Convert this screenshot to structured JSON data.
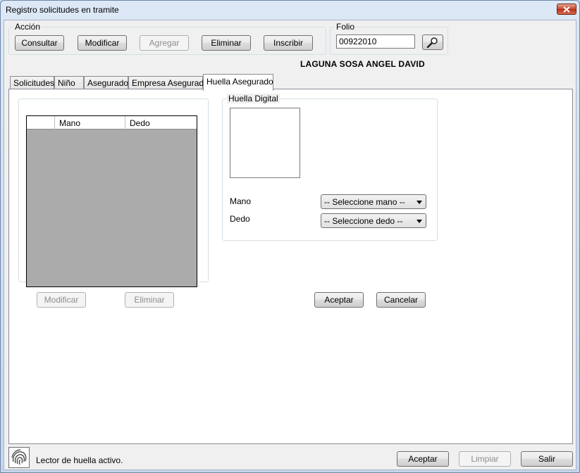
{
  "window": {
    "title": "Registro solicitudes en tramite"
  },
  "accion": {
    "legend": "Acción",
    "buttons": {
      "consultar": "Consultar",
      "modificar": "Modificar",
      "agregar": "Agregar",
      "eliminar": "Eliminar",
      "inscribir": "Inscribir"
    }
  },
  "folio": {
    "legend": "Folio",
    "value": "00922010"
  },
  "asegurado_nombre": "LAGUNA SOSA ANGEL DAVID",
  "tabs": [
    {
      "label": "Solicitudes"
    },
    {
      "label": "Niño"
    },
    {
      "label": "Asegurado"
    },
    {
      "label": "Empresa Asegurado"
    },
    {
      "label": "Huella Asegurado"
    }
  ],
  "active_tab": "Huella Asegurado",
  "grid": {
    "columns": [
      "Mano",
      "Dedo"
    ]
  },
  "grid_buttons": {
    "modificar": "Modificar",
    "eliminar": "Eliminar"
  },
  "huella": {
    "legend": "Huella Digital",
    "mano_label": "Mano",
    "dedo_label": "Dedo",
    "mano_select": "-- Seleccione mano --",
    "dedo_select": "-- Seleccione dedo --",
    "aceptar": "Aceptar",
    "cancelar": "Cancelar"
  },
  "status": {
    "text": "Lector de huella activo."
  },
  "footer": {
    "aceptar": "Aceptar",
    "limpiar": "Limpiar",
    "salir": "Salir"
  },
  "colors": {
    "close_button": "#c7452c",
    "grid_background": "#ababab"
  },
  "icons": {
    "search": "magnifier-icon",
    "fingerprint": "fingerprint-icon",
    "close": "close-icon"
  }
}
